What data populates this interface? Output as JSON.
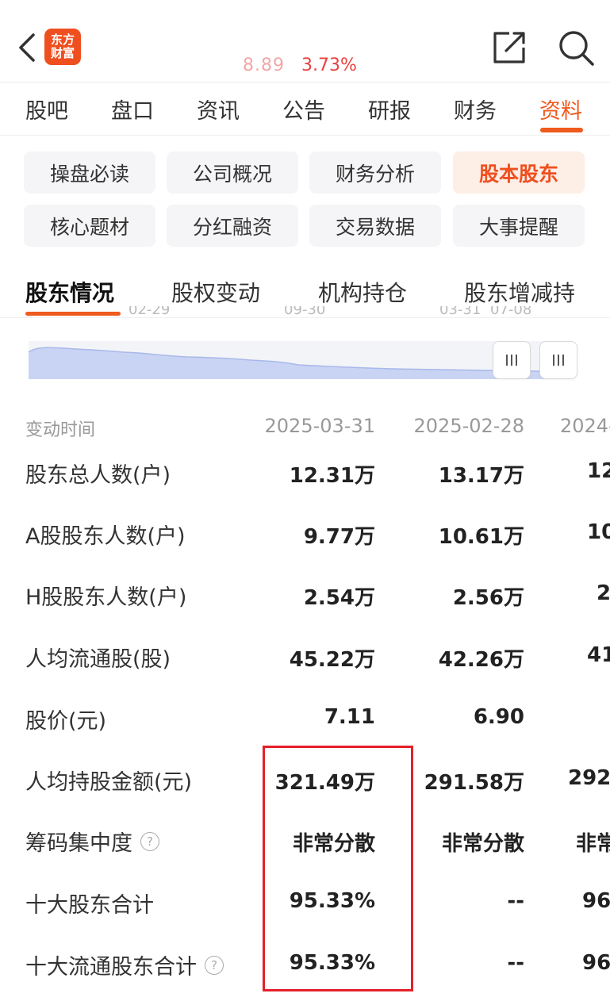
{
  "header": {
    "logo_line1": "东方",
    "logo_line2": "财富",
    "price": "8.89",
    "change_pct": "3.73%"
  },
  "top_tabs": [
    "股吧",
    "盘口",
    "资讯",
    "公告",
    "研报",
    "财务",
    "资料"
  ],
  "top_tab_active": "资料",
  "chips": [
    "操盘必读",
    "公司概况",
    "财务分析",
    "股本股东",
    "核心题材",
    "分红融资",
    "交易数据",
    "大事提醒"
  ],
  "chip_active": "股本股东",
  "sub_tabs": [
    "股东情况",
    "股权变动",
    "机构持仓",
    "股东增减持"
  ],
  "sub_tab_active": "股东情况",
  "mini_chart": {
    "tick_labels": [
      "02-29",
      "09-30",
      "03-31",
      "07-08"
    ]
  },
  "table": {
    "header_label": "变动时间",
    "dates": [
      "2025-03-31",
      "2025-02-28",
      "2024-"
    ],
    "rows": [
      {
        "label": "股东总人数(户)",
        "values": [
          "12.31万",
          "13.17万",
          "12"
        ]
      },
      {
        "label": "A股股东人数(户)",
        "values": [
          "9.77万",
          "10.61万",
          "10"
        ]
      },
      {
        "label": "H股股东人数(户)",
        "values": [
          "2.54万",
          "2.56万",
          "2"
        ]
      },
      {
        "label": "人均流通股(股)",
        "values": [
          "45.22万",
          "42.26万",
          "41"
        ]
      },
      {
        "label": "股价(元)",
        "values": [
          "7.11",
          "6.90",
          ""
        ]
      },
      {
        "label": "人均持股金额(元)",
        "values": [
          "321.49万",
          "291.58万",
          "292"
        ]
      },
      {
        "label": "筹码集中度",
        "values": [
          "非常分散",
          "非常分散",
          "非常"
        ]
      },
      {
        "label": "十大股东合计",
        "values": [
          "95.33%",
          "--",
          "96"
        ]
      },
      {
        "label": "十大流通股东合计",
        "values": [
          "95.33%",
          "--",
          "96"
        ]
      }
    ]
  },
  "help_glyph": "?",
  "colors": {
    "accent": "#ef5a1e",
    "highlight_box": "#e5202a",
    "ticker_red": "#e8403f"
  }
}
